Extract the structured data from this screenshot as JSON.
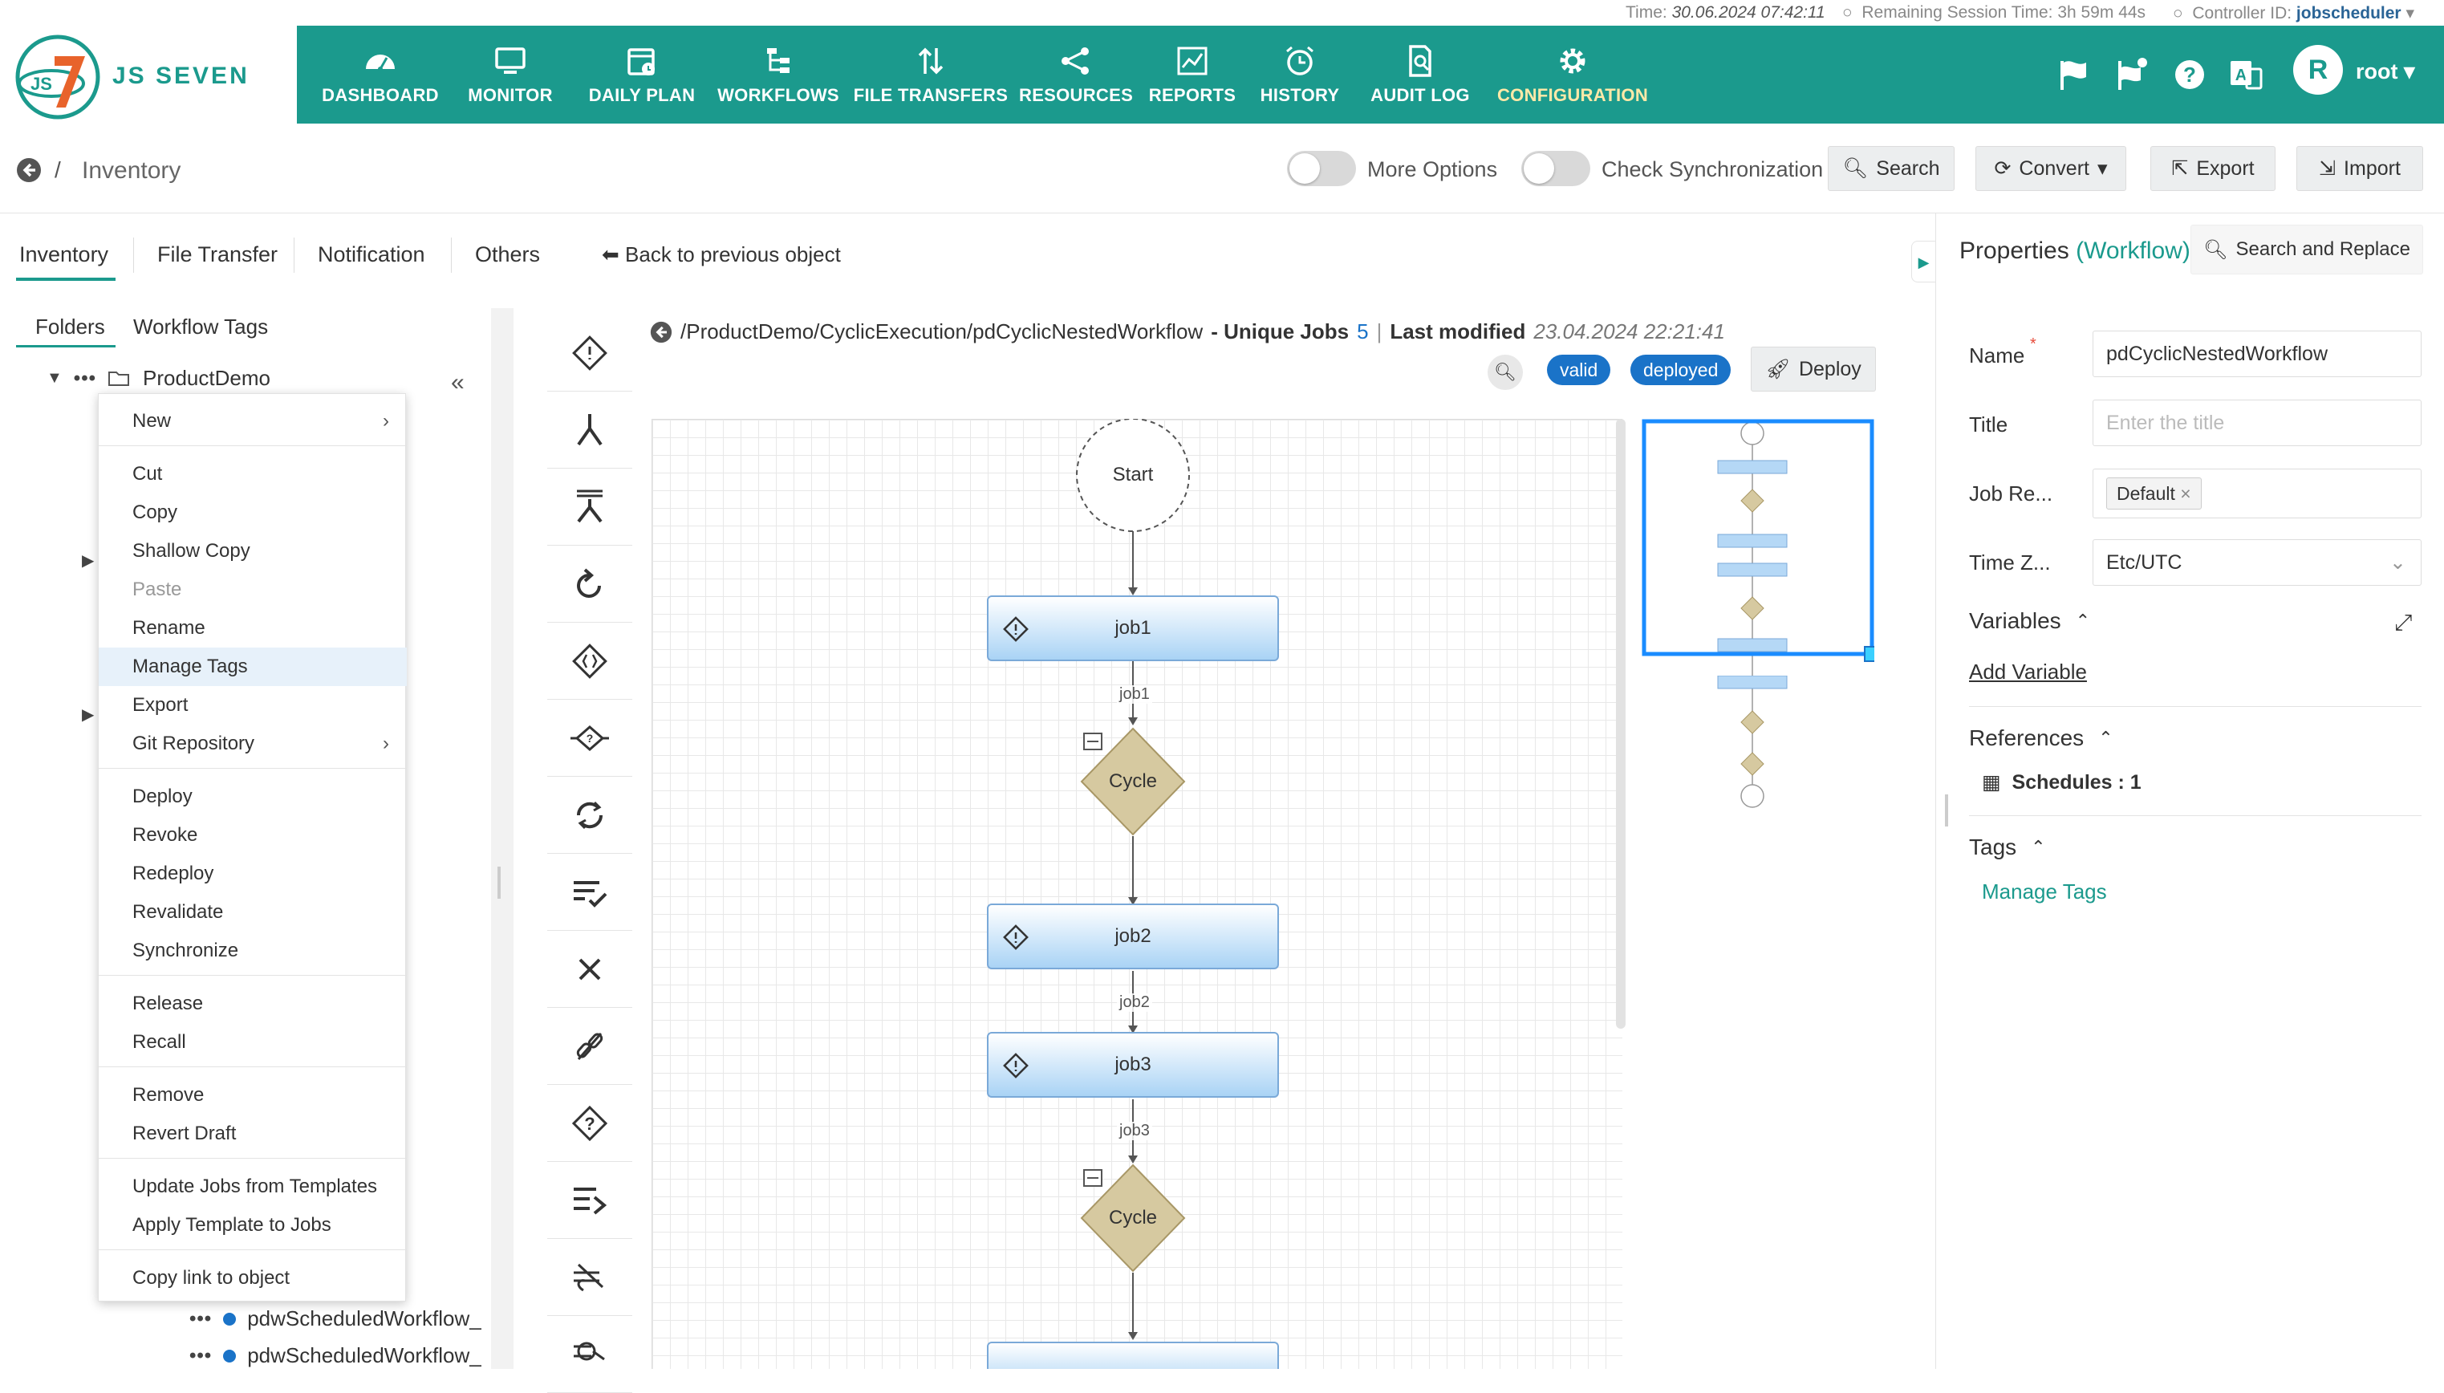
{
  "status": {
    "time_label": "Time:",
    "time_value": "30.06.2024 07:42:11",
    "session_label": "Remaining Session Time:",
    "session_value": "3h 59m 44s",
    "controller_label": "Controller ID:",
    "controller_value": "jobscheduler"
  },
  "brand": {
    "name": "JS SEVEN",
    "logo_text": "JS"
  },
  "nav": [
    {
      "label": "DASHBOARD",
      "icon": "dashboard-icon"
    },
    {
      "label": "MONITOR",
      "icon": "monitor-icon"
    },
    {
      "label": "DAILY PLAN",
      "icon": "calendar-icon"
    },
    {
      "label": "WORKFLOWS",
      "icon": "workflow-icon"
    },
    {
      "label": "FILE TRANSFERS",
      "icon": "transfer-icon"
    },
    {
      "label": "RESOURCES",
      "icon": "share-icon"
    },
    {
      "label": "REPORTS",
      "icon": "chart-icon"
    },
    {
      "label": "HISTORY",
      "icon": "clock-icon"
    },
    {
      "label": "AUDIT LOG",
      "icon": "audit-icon"
    },
    {
      "label": "CONFIGURATION",
      "icon": "gear-icon"
    }
  ],
  "user": {
    "avatar": "R",
    "name": "root"
  },
  "subheader": {
    "breadcrumb_sep": "/",
    "title": "Inventory",
    "more_options": "More Options",
    "check_sync": "Check Synchronization",
    "search": "Search",
    "convert": "Convert",
    "export": "Export",
    "import": "Import"
  },
  "tabs": [
    "Inventory",
    "File Transfer",
    "Notification",
    "Others"
  ],
  "back_prev": "Back to previous object",
  "subtabs": [
    "Folders",
    "Workflow Tags"
  ],
  "tree": {
    "root": "ProductDemo",
    "leaves": [
      "pdwScheduledWorkflow_",
      "pdwScheduledWorkflow_"
    ]
  },
  "context_menu": {
    "new": "New",
    "cut": "Cut",
    "copy": "Copy",
    "shallow_copy": "Shallow Copy",
    "paste": "Paste",
    "rename": "Rename",
    "manage_tags": "Manage Tags",
    "export": "Export",
    "git": "Git Repository",
    "deploy": "Deploy",
    "revoke": "Revoke",
    "redeploy": "Redeploy",
    "revalidate": "Revalidate",
    "synchronize": "Synchronize",
    "release": "Release",
    "recall": "Recall",
    "remove": "Remove",
    "revert_draft": "Revert Draft",
    "update_jobs": "Update Jobs from Templates",
    "apply_template": "Apply Template to Jobs",
    "copy_link": "Copy link to object"
  },
  "canvas": {
    "path": "/ProductDemo/CyclicExecution/pdCyclicNestedWorkflow",
    "unique_label": "- Unique Jobs",
    "unique_count": "5",
    "last_modified_label": "Last modified",
    "last_modified_value": "23.04.2024 22:21:41",
    "badge_valid": "valid",
    "badge_deployed": "deployed",
    "deploy": "Deploy",
    "start": "Start",
    "jobs": [
      "job1",
      "job2",
      "job3"
    ],
    "edge_labels": [
      "job1",
      "job2",
      "job3"
    ],
    "cycle": "Cycle"
  },
  "props": {
    "title_prefix": "Properties",
    "title_type": "(Workflow)",
    "search_replace": "Search and Replace",
    "name_label": "Name",
    "name_value": "pdCyclicNestedWorkflow",
    "title_label": "Title",
    "title_placeholder": "Enter the title",
    "job_res_label": "Job Re...",
    "job_res_value": "Default",
    "tz_label": "Time Z...",
    "tz_value": "Etc/UTC",
    "variables": "Variables",
    "add_variable": "Add Variable",
    "references": "References",
    "schedules": "Schedules : 1",
    "tags": "Tags",
    "manage_tags": "Manage Tags"
  },
  "colors": {
    "primary": "#1b9a8d",
    "badge": "#1a73c8",
    "job_fill": "#a9d3f5",
    "cycle_fill": "#cdbf95"
  }
}
